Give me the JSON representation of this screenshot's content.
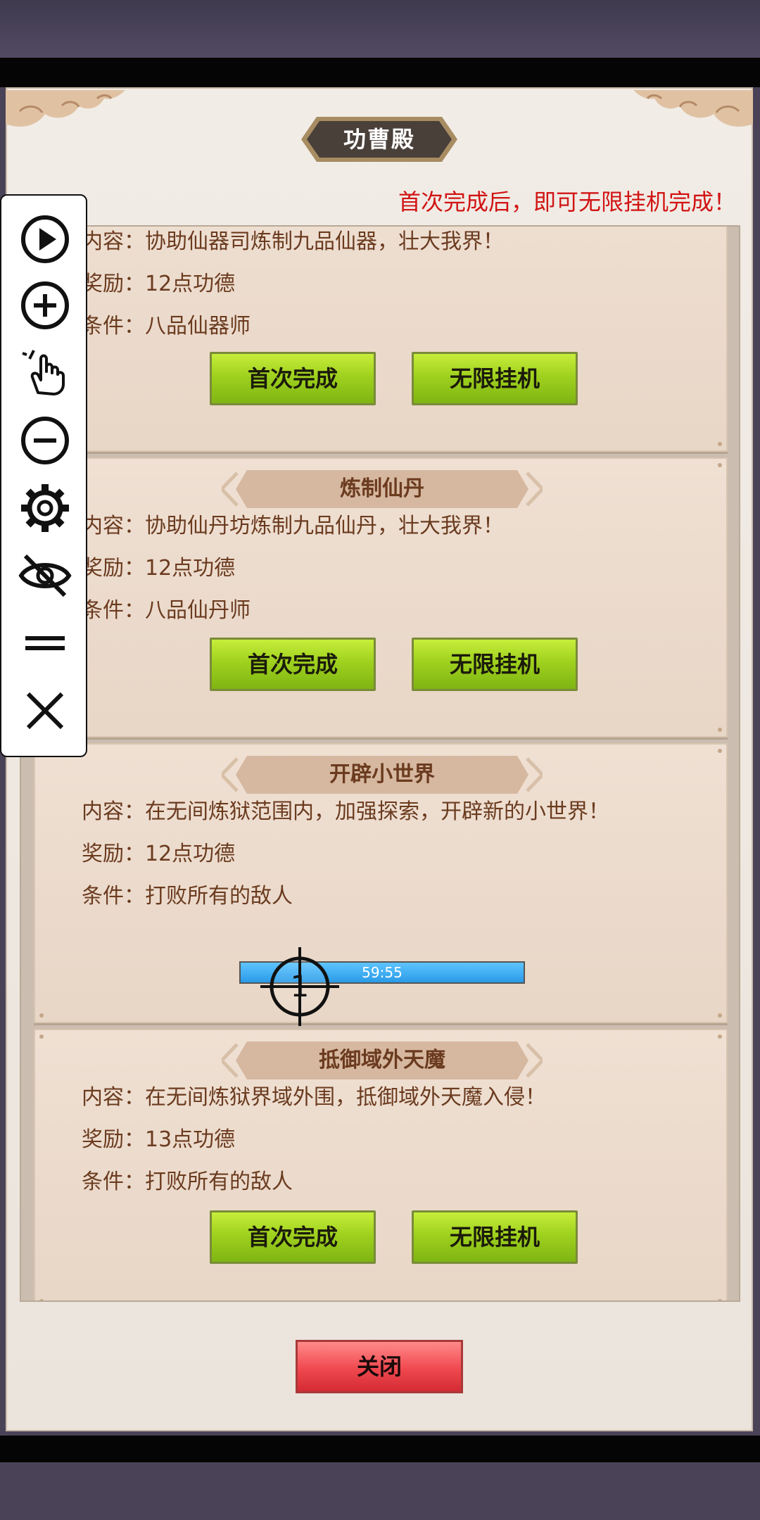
{
  "window": {
    "title": "功曹殿"
  },
  "notice": "首次完成后，即可无限挂机完成！",
  "cards": [
    {
      "title": "",
      "content": "内容：协助仙器司炼制九品仙器，壮大我界！",
      "reward": "奖励：12点功德",
      "condition": "条件：八品仙器师",
      "buttons": {
        "first": "首次完成",
        "infinite": "无限挂机"
      }
    },
    {
      "title": "炼制仙丹",
      "content": "内容：协助仙丹坊炼制九品仙丹，壮大我界！",
      "reward": "奖励：12点功德",
      "condition": "条件：八品仙丹师",
      "buttons": {
        "first": "首次完成",
        "infinite": "无限挂机"
      }
    },
    {
      "title": "开辟小世界",
      "content": "内容：在无间炼狱范围内，加强探索，开辟新的小世界！",
      "reward": "奖励：12点功德",
      "condition": "条件：打败所有的敌人",
      "progress": {
        "time": "59:55",
        "fraction": 1.0,
        "crosshair_number": "1"
      }
    },
    {
      "title": "抵御域外天魔",
      "content": "内容：在无间炼狱界域外围，抵御域外天魔入侵！",
      "reward": "奖励：13点功德",
      "condition": "条件：打败所有的敌人",
      "buttons": {
        "first": "首次完成",
        "infinite": "无限挂机"
      }
    }
  ],
  "close_label": "关闭",
  "toolbar": {
    "icons": [
      "play-icon",
      "zoom-in-icon",
      "tap-hand-icon",
      "zoom-out-icon",
      "gear-icon",
      "eye-off-icon",
      "menu-equals-icon",
      "close-icon"
    ]
  },
  "colors": {
    "notice": "#d11414",
    "text": "#6b3b1f",
    "button_green": "#9fd11e",
    "close_red": "#f0484f",
    "progress_blue": "#2a9be8"
  }
}
